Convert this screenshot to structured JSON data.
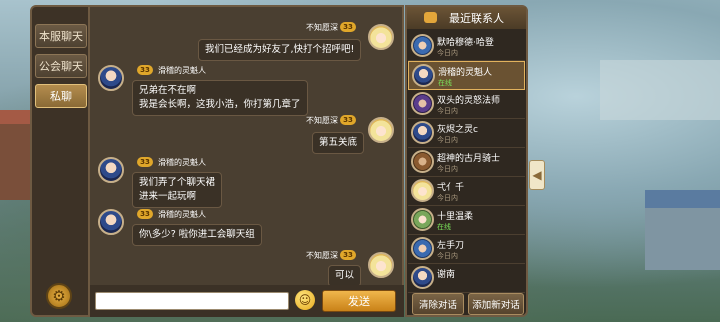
{
  "tabs": [
    "本服聊天",
    "公会聊天",
    "私聊"
  ],
  "active_tab": 2,
  "messages": [
    {
      "side": "right",
      "name": "不知愿深",
      "level": "33",
      "text": "我们已经成为好友了,快打个招呼吧!",
      "avatar": "girl"
    },
    {
      "side": "left",
      "name": "滑稽的灵魁人",
      "level": "33",
      "text": "兄弟在不在啊\n我是会长啊，这我小浩，你打第几章了",
      "avatar": "knight"
    },
    {
      "side": "right",
      "name": "不知愿深",
      "level": "33",
      "text": "第五关底",
      "avatar": "girl"
    },
    {
      "side": "left",
      "name": "滑稽的灵魁人",
      "level": "33",
      "text": "我们弄了个聊天裙\n进来一起玩啊",
      "avatar": "knight"
    },
    {
      "side": "left",
      "name": "滑稽的灵魁人",
      "level": "33",
      "text": "你\\多少? 啦你进工会聊天组",
      "avatar": "knight"
    },
    {
      "side": "right",
      "name": "不知愿深",
      "level": "33",
      "text": "可以",
      "avatar": "girl"
    }
  ],
  "input": {
    "value": "",
    "placeholder": ""
  },
  "send_label": "发送",
  "recent": {
    "title": "最近联系人",
    "contacts": [
      {
        "name": "默哈穆德·哈登",
        "status": "今日内",
        "online": false,
        "avatar": "blue"
      },
      {
        "name": "滑稽的灵魁人",
        "status": "在线",
        "online": true,
        "avatar": "knight",
        "selected": true
      },
      {
        "name": "双头的灵怒法师",
        "status": "今日内",
        "online": false,
        "avatar": "mage"
      },
      {
        "name": "灰烬之灵c",
        "status": "今日内",
        "online": false,
        "avatar": "knight"
      },
      {
        "name": "超神的古月骑士",
        "status": "今日内",
        "online": false,
        "avatar": "dwarf"
      },
      {
        "name": "弌亻千",
        "status": "今日内",
        "online": false,
        "avatar": "girl"
      },
      {
        "name": "十里温柔",
        "status": "在线",
        "online": true,
        "avatar": "elf"
      },
      {
        "name": "左手刀",
        "status": "今日内",
        "online": false,
        "avatar": "blue"
      },
      {
        "name": "谢南",
        "status": "",
        "online": false,
        "avatar": "knight"
      }
    ],
    "clear_label": "清除对话",
    "add_label": "添加新对话"
  },
  "colors": {
    "accent": "#e0a72a",
    "online": "#7be25a"
  }
}
